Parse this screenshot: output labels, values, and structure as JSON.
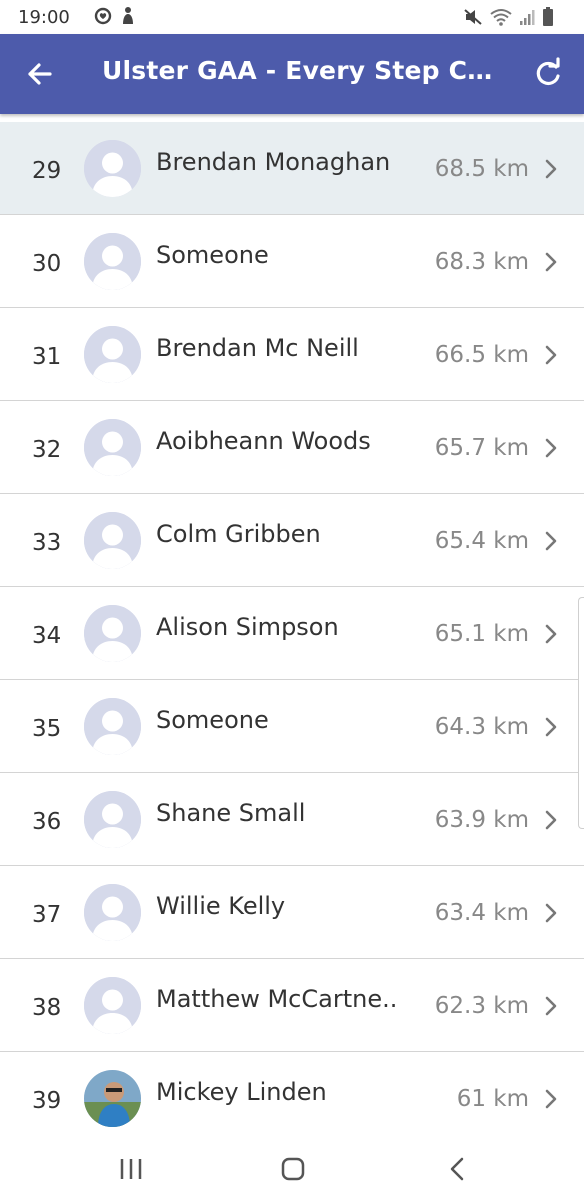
{
  "status_bar": {
    "time": "19:00",
    "left_icons": [
      "shield-notification-icon",
      "pet-notification-icon"
    ],
    "right_icons": [
      "mute-icon",
      "wifi-icon",
      "signal-icon",
      "battery-icon"
    ]
  },
  "app_bar": {
    "title": "Ulster GAA - Every Step Cou...",
    "back_icon": "arrow-left-icon",
    "refresh_icon": "refresh-icon",
    "color": "#4d5bab"
  },
  "leaderboard": {
    "rows": [
      {
        "rank": "29",
        "name": "Brendan Monaghan",
        "distance": "68.5 km",
        "highlighted": true
      },
      {
        "rank": "30",
        "name": "Someone",
        "distance": "68.3 km"
      },
      {
        "rank": "31",
        "name": "Brendan Mc Neill",
        "distance": "66.5 km"
      },
      {
        "rank": "32",
        "name": "Aoibheann Woods",
        "distance": "65.7 km"
      },
      {
        "rank": "33",
        "name": "Colm Gribben",
        "distance": "65.4 km"
      },
      {
        "rank": "34",
        "name": "Alison Simpson",
        "distance": "65.1 km"
      },
      {
        "rank": "35",
        "name": "Someone",
        "distance": "64.3 km"
      },
      {
        "rank": "36",
        "name": "Shane Small",
        "distance": "63.9 km"
      },
      {
        "rank": "37",
        "name": "Willie Kelly",
        "distance": "63.4 km"
      },
      {
        "rank": "38",
        "name": "Matthew McCartne..",
        "distance": "62.3 km"
      },
      {
        "rank": "39",
        "name": "Mickey Linden",
        "distance": "61 km",
        "photo_avatar": true
      }
    ]
  },
  "nav_bar": {
    "buttons": [
      "recent-apps-icon",
      "home-icon",
      "back-icon"
    ]
  }
}
